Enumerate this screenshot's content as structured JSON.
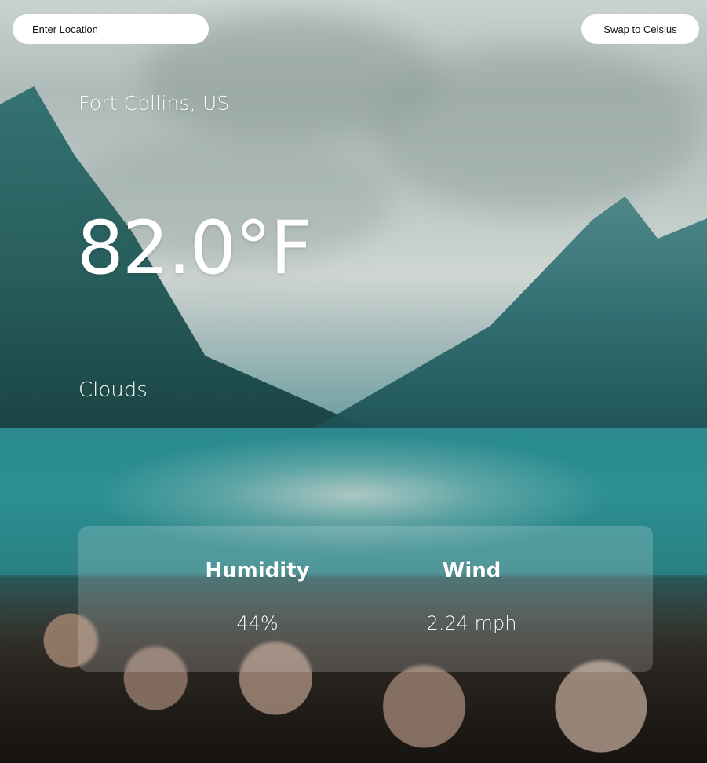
{
  "search": {
    "placeholder": "Enter Location",
    "value": ""
  },
  "actions": {
    "swap_label": "Swap to Celsius"
  },
  "weather": {
    "location": "Fort Collins, US",
    "temperature": "82.0°F",
    "condition": "Clouds"
  },
  "stats": {
    "humidity": {
      "label": "Humidity",
      "value": "44%"
    },
    "wind": {
      "label": "Wind",
      "value": "2.24 mph"
    }
  }
}
